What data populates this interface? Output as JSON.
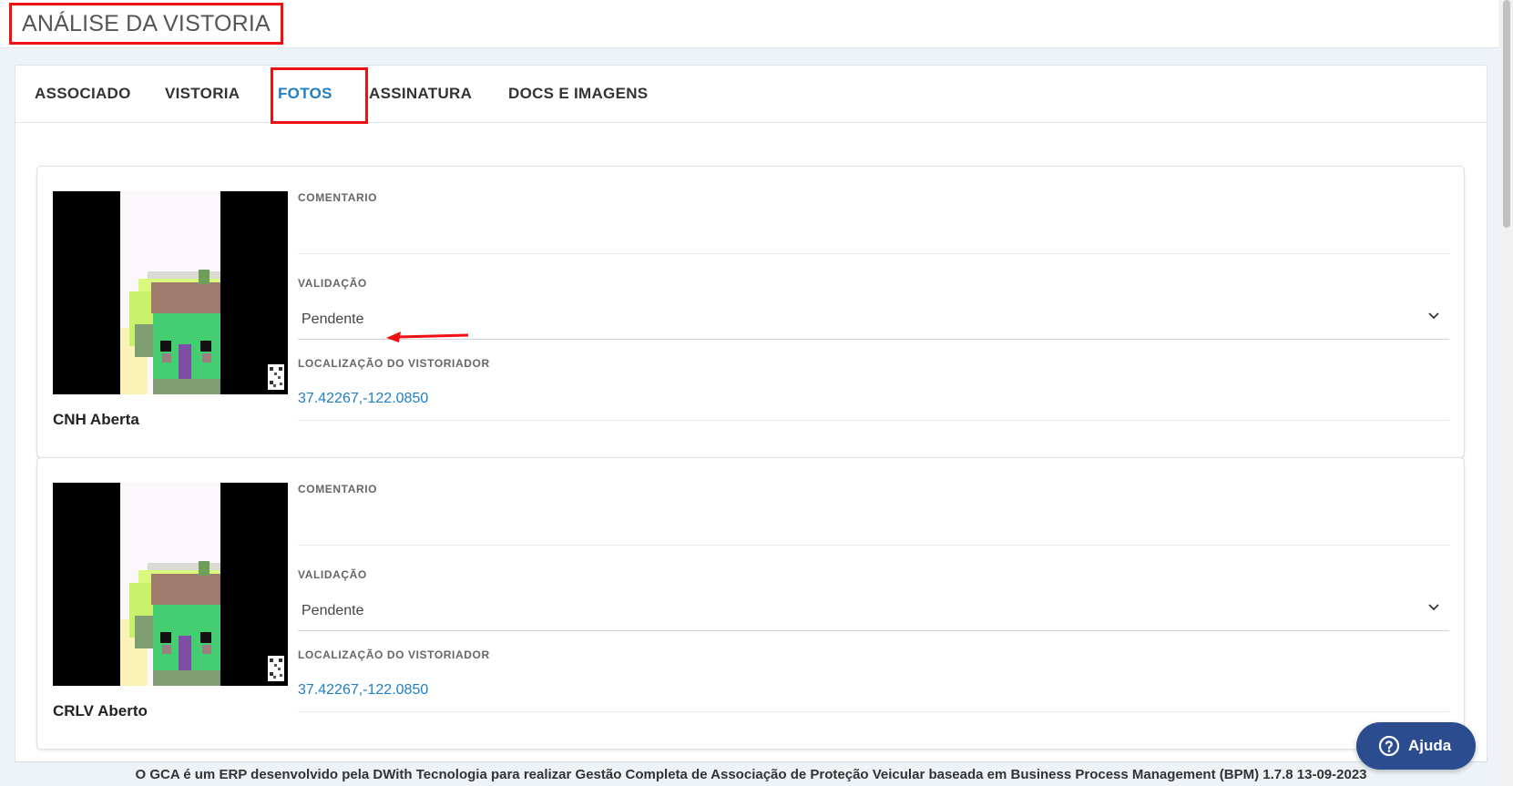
{
  "header": {
    "title": "ANÁLISE DA VISTORIA"
  },
  "tabs": [
    {
      "label": "ASSOCIADO",
      "active": false
    },
    {
      "label": "VISTORIA",
      "active": false
    },
    {
      "label": "FOTOS",
      "active": true
    },
    {
      "label": "ASSINATURA",
      "active": false
    },
    {
      "label": "DOCS E IMAGENS",
      "active": false
    }
  ],
  "photos": [
    {
      "label": "CNH Aberta",
      "comment_label": "COMENTARIO",
      "comment_value": "",
      "validation_label": "VALIDAÇÃO",
      "validation_value": "Pendente",
      "location_label": "LOCALIZAÇÃO DO VISTORIADOR",
      "location_value": "37.42267,-122.0850"
    },
    {
      "label": "CRLV Aberto",
      "comment_label": "COMENTARIO",
      "comment_value": "",
      "validation_label": "VALIDAÇÃO",
      "validation_value": "Pendente",
      "location_label": "LOCALIZAÇÃO DO VISTORIADOR",
      "location_value": "37.42267,-122.0850"
    }
  ],
  "footer": {
    "text": "O GCA é um ERP desenvolvido pela DWith Tecnologia para realizar Gestão Completa de Associação de Proteção Veicular baseada em Business Process Management (BPM) 1.7.8 13-09-2023"
  },
  "help": {
    "label": "Ajuda",
    "icon": "question-circle-icon"
  },
  "colors": {
    "accent": "#1f7fc4",
    "highlight": "#ee1111",
    "help_button": "#2b4c8f",
    "background": "#eef3f8"
  }
}
